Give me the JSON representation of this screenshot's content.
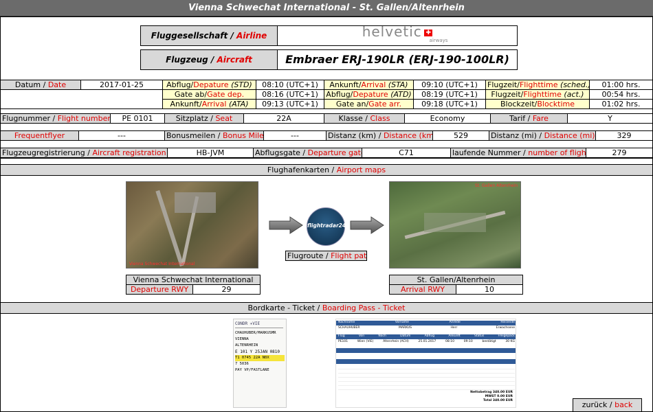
{
  "header": {
    "title": "Vienna Schwechat International - St. Gallen/Altenrhein"
  },
  "airline": {
    "label_de": "Fluggesellschaft",
    "label_en": "Airline",
    "logo_text": "helvetic",
    "logo_sub": "airways"
  },
  "aircraft": {
    "label_de": "Flugzeug",
    "label_en": "Aircraft",
    "value": "Embraer ERJ-190LR (ERJ-190-100LR)"
  },
  "row1": {
    "date_de": "Datum",
    "date_en": "Date",
    "date_value": "2017-01-25",
    "std_de": "Abflug/",
    "std_en": "Depature",
    "std_abbr": "(STD)",
    "std_value": "08:10 (UTC+1)",
    "sta_de": "Ankunft/",
    "sta_en": "Arrival",
    "sta_abbr": "(STA)",
    "sta_value": "09:10 (UTC+1)",
    "fts_de": "Flugzeit/",
    "fts_en": "Flighttime",
    "fts_abbr": "(sched.)",
    "fts_value": "01:00 hrs."
  },
  "row2": {
    "gatedep_de": "Gate ab/",
    "gatedep_en": "Gate dep.",
    "gatedep_value": "08:16 (UTC+1)",
    "atd_de": "Abflug/",
    "atd_en": "Depature",
    "atd_abbr": "(ATD)",
    "atd_value": "08:19 (UTC+1)",
    "fta_de": "Flugzeit/",
    "fta_en": "Flighttime",
    "fta_abbr": "(act.)",
    "fta_value": "00:54 hrs."
  },
  "row3": {
    "ata_de": "Ankunft/",
    "ata_en": "Arrival",
    "ata_abbr": "(ATA)",
    "ata_value": "09:13 (UTC+1)",
    "gatearr_de": "Gate an/",
    "gatearr_en": "Gate arr.",
    "gatearr_value": "09:18 (UTC+1)",
    "block_de": "Blockzeit/",
    "block_en": "Blocktime",
    "block_value": "01:02 hrs."
  },
  "row4": {
    "flightno_de": "Flugnummer",
    "flightno_en": "Flight number",
    "flightno_value": "PE 0101",
    "seat_de": "Sitzplatz",
    "seat_en": "Seat",
    "seat_value": "22A",
    "class_de": "Klasse",
    "class_en": "Class",
    "class_value": "Economy",
    "fare_de": "Tarif",
    "fare_en": "Fare",
    "fare_value": "Y"
  },
  "row5": {
    "ff_en": "Frequentflyer",
    "ff_value": "---",
    "miles_de": "Bonusmeilen",
    "miles_en": "Bonus Miles",
    "miles_value": "---",
    "distkm_de": "Distanz (km)",
    "distkm_en": "Distance (km)",
    "distkm_value": "529",
    "distmi_de": "Distanz (mi)",
    "distmi_en": "Distance (mi)",
    "distmi_value": "329"
  },
  "row6": {
    "reg_de": "Flugzeugregistrierung",
    "reg_en": "Aircraft registration",
    "reg_value": "HB-JVM",
    "gate_de": "Abflugsgate",
    "gate_en": "Departure gate",
    "gate_value": "C71",
    "num_de": "laufende Nummer",
    "num_en": "number of flights",
    "num_value": "279"
  },
  "maps": {
    "header_de": "Flughafenkarten",
    "header_en": "Airport maps",
    "dep_photo_caption": "Vienna Schwechat International",
    "arr_photo_caption": "St. Gallen Altenrhein",
    "fr24_text": "flightradar24",
    "flightpath_de": "Flugroute",
    "flightpath_en": "Flight path",
    "dep_airport": "Vienna Schwechat International",
    "dep_rwy_label": "Departure RWY",
    "dep_rwy_value": "29",
    "arr_airport": "St. Gallen/Altenrhein",
    "arr_rwy_label": "Arrival RWY",
    "arr_rwy_value": "10"
  },
  "boarding": {
    "header_de": "Bordkarte - Ticket",
    "header_en": "Boarding Pass - Ticket",
    "pass_lines": [
      "CHAUHUBER/MARKUSMR",
      "VIENNA",
      "ALTENRHEIN",
      "E 101  Y 25JAN 0810",
      "T1  0745  22A  N0X",
      "7    5036",
      "PAY VP/FASTLANE"
    ],
    "ticket_header": [
      "Nachname",
      "Vorname",
      "Anrede",
      "Reisende"
    ],
    "ticket_row1": [
      "SCHAUHUBER",
      "MARKUS",
      "Herr",
      "Erwachsene"
    ],
    "flight_header": [
      "Flug",
      "Von",
      "Nach",
      "Datum",
      "Abflug",
      "Ankunft",
      "Status",
      "Freigepäck"
    ],
    "flight_row": [
      "PE101",
      "Wien (VIE)",
      "Altenrhein (ACH)",
      "25.01.2017",
      "08:10",
      "09:10",
      "bestätigt",
      "30 KG"
    ],
    "totals": [
      "Nettobetrag",
      "340.00 EUR",
      "MWST",
      "0.00 EUR",
      "Total",
      "340.00 EUR"
    ]
  },
  "footer": {
    "back_de": "zurück",
    "back_en": "back"
  }
}
